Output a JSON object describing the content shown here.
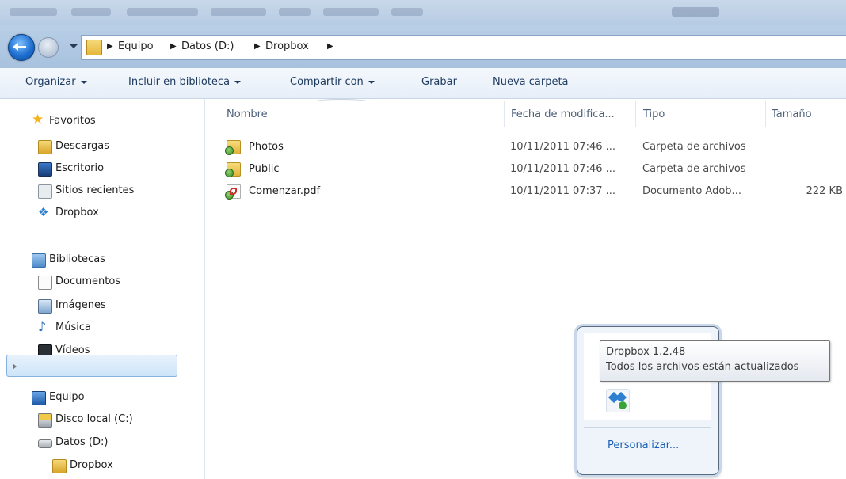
{
  "breadcrumb": [
    "Equipo",
    "Datos (D:)",
    "Dropbox"
  ],
  "toolbar": {
    "organize": "Organizar",
    "include_library": "Incluir en biblioteca",
    "share_with": "Compartir con",
    "burn": "Grabar",
    "new_folder": "Nueva carpeta"
  },
  "nav": {
    "favorites": {
      "header": "Favoritos",
      "items": [
        "Descargas",
        "Escritorio",
        "Sitios recientes",
        "Dropbox"
      ]
    },
    "libraries": {
      "header": "Bibliotecas",
      "items": [
        "Documentos",
        "Imágenes",
        "Música",
        "Vídeos"
      ]
    },
    "computer": {
      "header": "Equipo",
      "items": [
        "Disco local (C:)",
        "Datos (D:)",
        "Dropbox"
      ]
    },
    "selected": "Dropbox"
  },
  "columns": {
    "name": "Nombre",
    "modified": "Fecha de modifica...",
    "type": "Tipo",
    "size": "Tamaño"
  },
  "files": [
    {
      "name": "Photos",
      "modified": "10/11/2011 07:46 ...",
      "type": "Carpeta de archivos",
      "size": "",
      "icon": "synced-folder-icon"
    },
    {
      "name": "Public",
      "modified": "10/11/2011 07:46 ...",
      "type": "Carpeta de archivos",
      "size": "",
      "icon": "synced-folder-icon"
    },
    {
      "name": "Comenzar.pdf",
      "modified": "10/11/2011 07:37 ...",
      "type": "Documento Adob...",
      "size": "222 KB",
      "icon": "pdf-file-icon"
    }
  ],
  "tray": {
    "tooltip_title": "Dropbox 1.2.48",
    "tooltip_status": "Todos los archivos están actualizados",
    "customize": "Personalizar..."
  },
  "colors": {
    "accent": "#1a5fb4",
    "selection": "#cde4f9",
    "toolbar_text": "#1e3a5f"
  }
}
